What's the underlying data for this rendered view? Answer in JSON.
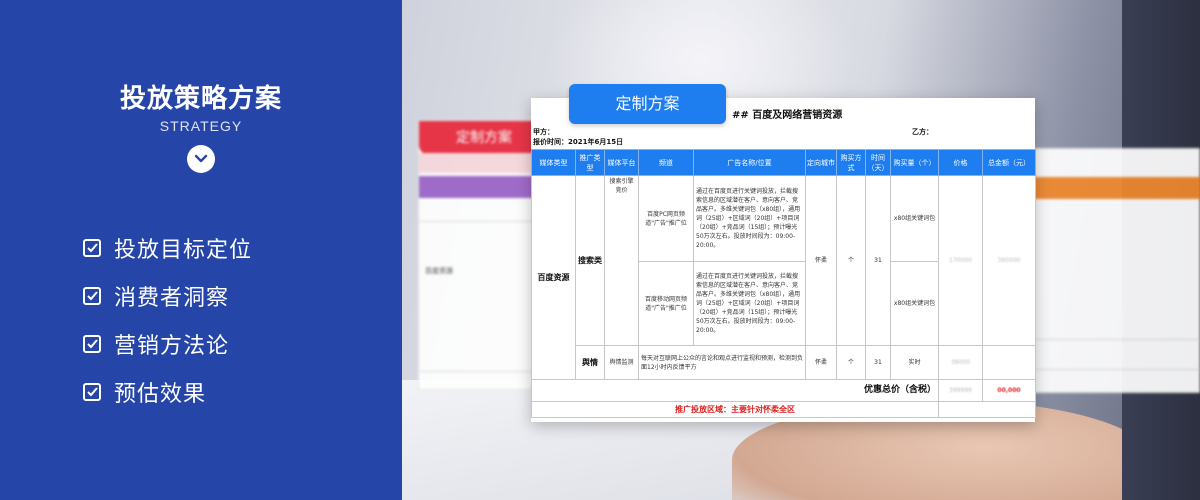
{
  "left_panel": {
    "title": "投放策略方案",
    "subtitle": "STRATEGY",
    "chevron_icon": "chevron-down-icon",
    "goals": [
      {
        "icon": "checkbox-icon",
        "label": "投放目标定位"
      },
      {
        "icon": "checkbox-icon",
        "label": "消费者洞察"
      },
      {
        "icon": "checkbox-icon",
        "label": "营销方法论"
      },
      {
        "icon": "checkbox-icon",
        "label": "预估效果"
      }
    ],
    "bg_color": "#2545a8"
  },
  "background_sheets": {
    "left_tag": "定制方案",
    "left_tag_color": "#e8283b",
    "left_media": "百度资源",
    "right_band_color": "#f0892c"
  },
  "main_sheet": {
    "tag": "定制方案",
    "title": "## 百度及网络营销资源",
    "party_a": "甲方：",
    "party_b": "乙方：",
    "quote_date": "报价时间：2021年6月15日",
    "headers": [
      "媒体类型",
      "推广类型",
      "媒体平台",
      "频道",
      "广告名称/位置",
      "定向城市",
      "购买方式",
      "时间（天）",
      "购买量（个）",
      "价格",
      "总金额（元）"
    ],
    "media_type": "百度资源",
    "promo_type_1": "搜索类",
    "promo_type_2": "舆情",
    "platform_1": "搜索引擎竞价",
    "platform_2": "舆情监测",
    "rows": [
      {
        "channel": "百度PC网页频道\"广告\"推广位",
        "description": "通过在百度页进行关键词投放，拦截搜索信息的区域潜在客户、意向客户、竞品客户。多维关键词包（x80组），通用词（25组）+区域词（20组）+项目词（20组）+竞品词（15组）；预计曝光50万次左右。投放时间段为：09:00-20:00。",
        "city": "怀柔",
        "buy": "个",
        "days": "31",
        "qty": "x80组关键词包",
        "price": "170000",
        "total": "360000"
      },
      {
        "channel": "百度移动网页频道\"广告\"推广位",
        "description": "通过在百度页进行关键词投放，拦截搜索信息的区域潜在客户、意向客户、竞品客户。多维关键词包（x80组），通用词（25组）+区域词（20组）+项目词（20组）+竞品词（15组）；预计曝光50万次左右。投放时间段为：09:00-20:00。",
        "city": "",
        "buy": "",
        "days": "",
        "qty": "x80组关键词包",
        "price": "",
        "total": ""
      },
      {
        "channel": "",
        "description": "每天对互联网上公众的言论和观点进行监视和预测，检测到负面12小时内反馈平方",
        "city": "怀柔",
        "buy": "个",
        "days": "31",
        "qty": "实时",
        "price": "38000",
        "total": ""
      }
    ],
    "total_label": "优惠总价（含税）",
    "total_value": "399999",
    "total_red": "00,000",
    "region_note": "推广投放区域：主要针对怀柔全区",
    "accent_color": "#1e7ef0"
  }
}
